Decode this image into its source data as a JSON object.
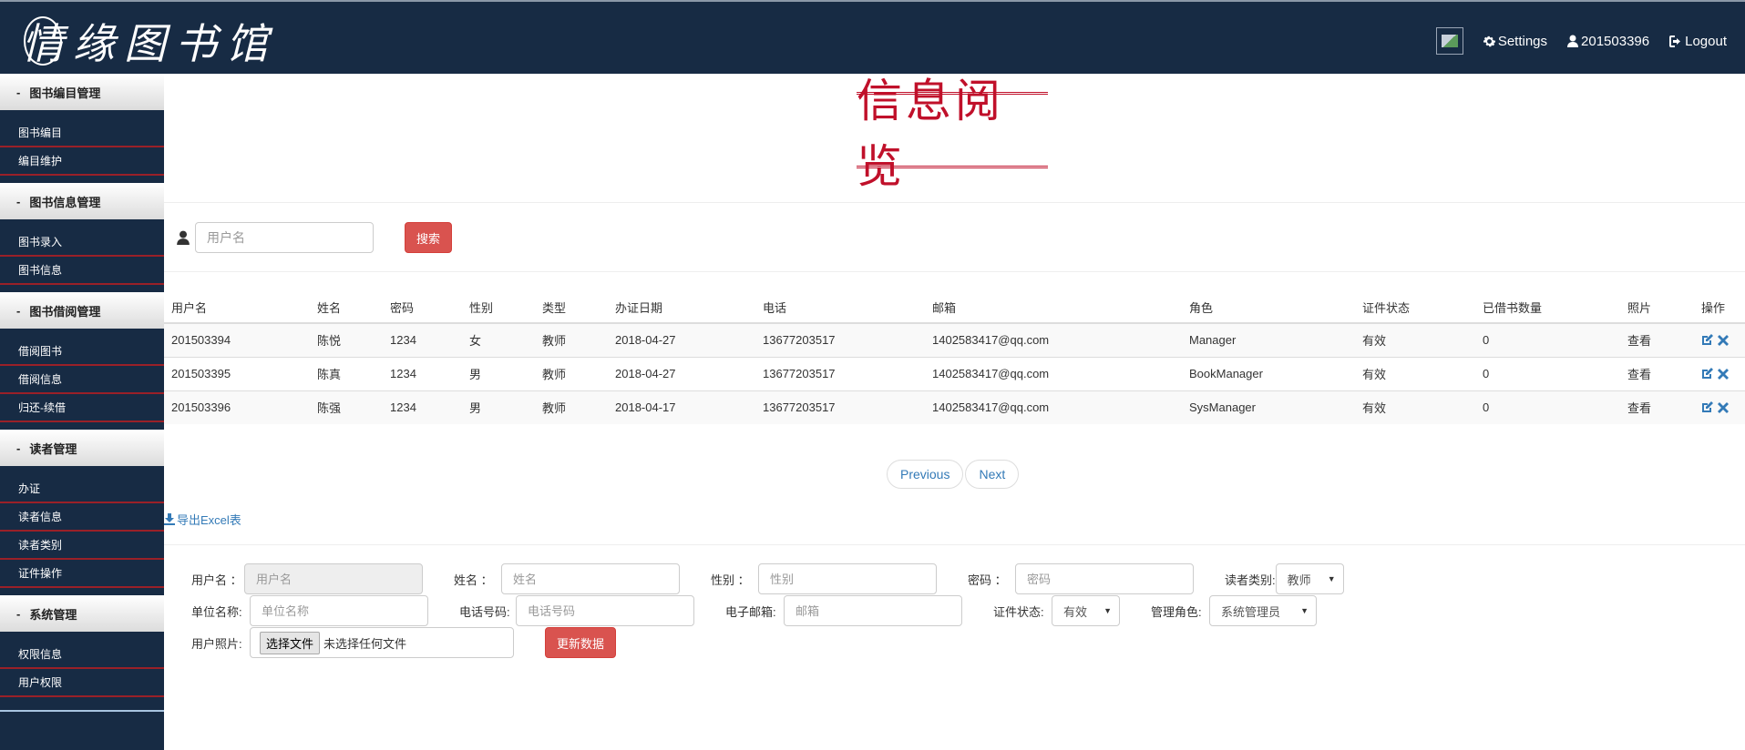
{
  "header": {
    "logo_text": "情缘图书馆",
    "settings_label": "Settings",
    "user_label": "201503396",
    "logout_label": "Logout"
  },
  "sidebar": {
    "groups": [
      {
        "title": "图书编目管理",
        "items": [
          "图书编目",
          "编目维护"
        ]
      },
      {
        "title": "图书信息管理",
        "items": [
          "图书录入",
          "图书信息"
        ]
      },
      {
        "title": "图书借阅管理",
        "items": [
          "借阅图书",
          "借阅信息",
          "归还-续借"
        ]
      },
      {
        "title": "读者管理",
        "items": [
          "办证",
          "读者信息",
          "读者类别",
          "证件操作"
        ]
      },
      {
        "title": "系统管理",
        "items": [
          "权限信息",
          "用户权限"
        ]
      }
    ]
  },
  "main": {
    "page_title": "信息阅览",
    "search": {
      "placeholder": "用户名",
      "button_label": "搜索"
    },
    "table": {
      "headers": [
        "用户名",
        "姓名",
        "密码",
        "性别",
        "类型",
        "办证日期",
        "电话",
        "邮箱",
        "角色",
        "证件状态",
        "已借书数量",
        "照片",
        "操作"
      ],
      "rows": [
        {
          "username": "201503394",
          "name": "陈悦",
          "password": "1234",
          "gender": "女",
          "type": "教师",
          "date": "2018-04-27",
          "phone": "13677203517",
          "email": "1402583417@qq.com",
          "role": "Manager",
          "status": "有效",
          "borrowed": "0",
          "photo": "查看"
        },
        {
          "username": "201503395",
          "name": "陈真",
          "password": "1234",
          "gender": "男",
          "type": "教师",
          "date": "2018-04-27",
          "phone": "13677203517",
          "email": "1402583417@qq.com",
          "role": "BookManager",
          "status": "有效",
          "borrowed": "0",
          "photo": "查看"
        },
        {
          "username": "201503396",
          "name": "陈强",
          "password": "1234",
          "gender": "男",
          "type": "教师",
          "date": "2018-04-17",
          "phone": "13677203517",
          "email": "1402583417@qq.com",
          "role": "SysManager",
          "status": "有效",
          "borrowed": "0",
          "photo": "查看"
        }
      ]
    },
    "pagination": {
      "previous": "Previous",
      "next": "Next"
    },
    "export_label": "导出Excel表",
    "form": {
      "username_label": "用户名 ：",
      "username_placeholder": "用户名",
      "name_label": "姓名 ：",
      "name_placeholder": "姓名",
      "gender_label": "性别 ：",
      "gender_placeholder": "性别",
      "password_label": "密码 ：",
      "password_placeholder": "密码",
      "reader_type_label": "读者类别:",
      "reader_type_value": "教师",
      "unit_label": "单位名称:",
      "unit_placeholder": "单位名称",
      "phone_label": "电话号码:",
      "phone_placeholder": "电话号码",
      "email_label": "电子邮箱:",
      "email_placeholder": "邮箱",
      "card_status_label": "证件状态:",
      "card_status_value": "有效",
      "admin_role_label": "管理角色:",
      "admin_role_value": "系统管理员",
      "photo_label": "用户照片:",
      "file_button": "选择文件",
      "file_status": "未选择任何文件",
      "update_button": "更新数据"
    }
  }
}
